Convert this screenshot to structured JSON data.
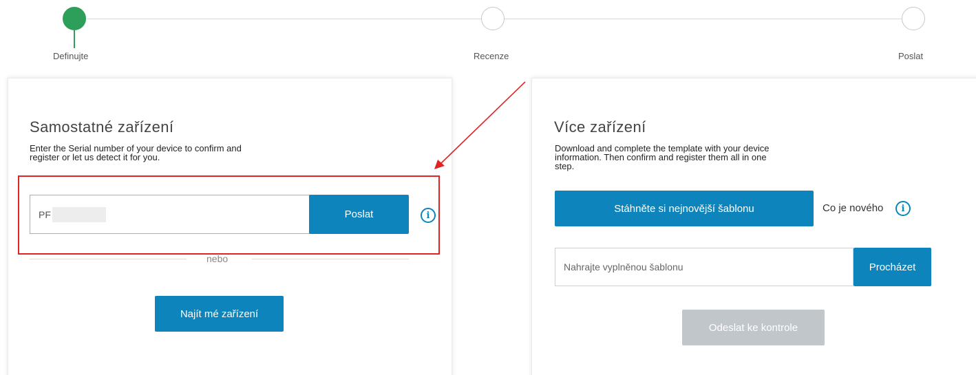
{
  "stepper": {
    "steps": [
      {
        "label": "Definujte",
        "active": true
      },
      {
        "label": "Recenze",
        "active": false
      },
      {
        "label": "Poslat",
        "active": false
      }
    ]
  },
  "single_device": {
    "title": "Samostatné zařízení",
    "description_line1": "Enter the Serial number of your device to confirm and",
    "description_line2": "register or let us detect it for you.",
    "serial_value": "PF",
    "submit_label": "Poslat",
    "info_icon": "info-icon",
    "or_label": "nebo",
    "find_device_label": "Najít mé zařízení"
  },
  "multiple_devices": {
    "title": "Více zařízení",
    "description_line1": "Download and complete the template with your device",
    "description_line2": "information. Then confirm and register them all in one",
    "description_line3": "step.",
    "download_label": "Stáhněte si nejnovější šablonu",
    "whats_new_label": "Co je nového",
    "upload_placeholder": "Nahrajte vyplněnou šablonu",
    "browse_label": "Procházet",
    "submit_review_label": "Odeslat ke kontrole"
  },
  "colors": {
    "primary": "#0d85bc",
    "success": "#2e9e5b",
    "disabled": "#c1c6cb",
    "annotation": "#e02424"
  }
}
